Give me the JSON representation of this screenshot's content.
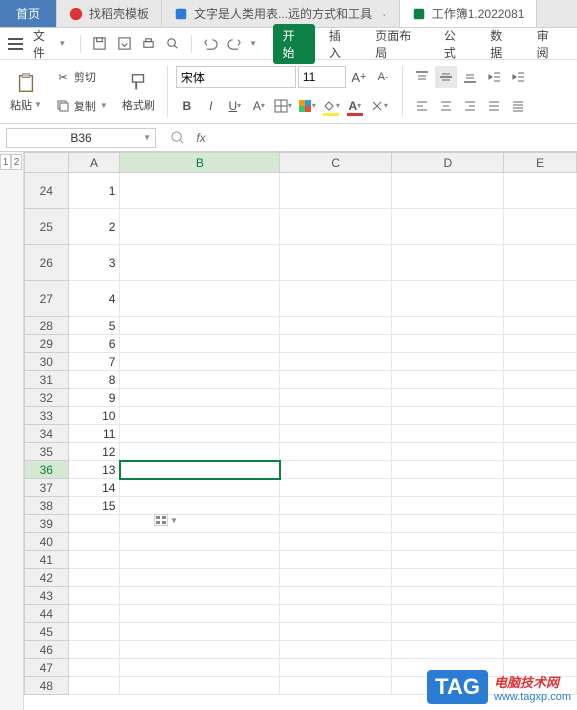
{
  "tabs": {
    "home": "首页",
    "t1": "找稻壳模板",
    "t2": "文字是人类用表...远的方式和工具",
    "t3": "工作簿1.2022081"
  },
  "menubar": {
    "file": "文件",
    "start": "开始",
    "insert": "插入",
    "pagelayout": "页面布局",
    "formula": "公式",
    "data": "数据",
    "review": "审阅"
  },
  "ribbon": {
    "paste": "粘贴",
    "cut": "剪切",
    "copy": "复制",
    "format_painter": "格式刷",
    "font_name": "宋体",
    "font_size": "11"
  },
  "formula": {
    "name_box": "B36",
    "fx": "fx",
    "input": ""
  },
  "sheet": {
    "side1": "1",
    "side2": "2",
    "cols": [
      "A",
      "B",
      "C",
      "D",
      "E"
    ],
    "rows": [
      {
        "num": "24",
        "a": "1",
        "tall": true
      },
      {
        "num": "25",
        "a": "2",
        "tall": true
      },
      {
        "num": "26",
        "a": "3",
        "tall": true
      },
      {
        "num": "27",
        "a": "4",
        "tall": true
      },
      {
        "num": "28",
        "a": "5"
      },
      {
        "num": "29",
        "a": "6"
      },
      {
        "num": "30",
        "a": "7"
      },
      {
        "num": "31",
        "a": "8"
      },
      {
        "num": "32",
        "a": "9"
      },
      {
        "num": "33",
        "a": "10"
      },
      {
        "num": "34",
        "a": "11"
      },
      {
        "num": "35",
        "a": "12"
      },
      {
        "num": "36",
        "a": "13",
        "sel": true
      },
      {
        "num": "37",
        "a": "14"
      },
      {
        "num": "38",
        "a": "15"
      },
      {
        "num": "39",
        "a": ""
      },
      {
        "num": "40",
        "a": ""
      },
      {
        "num": "41",
        "a": ""
      },
      {
        "num": "42",
        "a": ""
      },
      {
        "num": "43",
        "a": ""
      },
      {
        "num": "44",
        "a": ""
      },
      {
        "num": "45",
        "a": ""
      },
      {
        "num": "46",
        "a": ""
      },
      {
        "num": "47",
        "a": ""
      },
      {
        "num": "48",
        "a": ""
      }
    ]
  },
  "watermark": {
    "badge": "TAG",
    "line1": "电脑技术网",
    "line2": "www.tagxp.com"
  }
}
